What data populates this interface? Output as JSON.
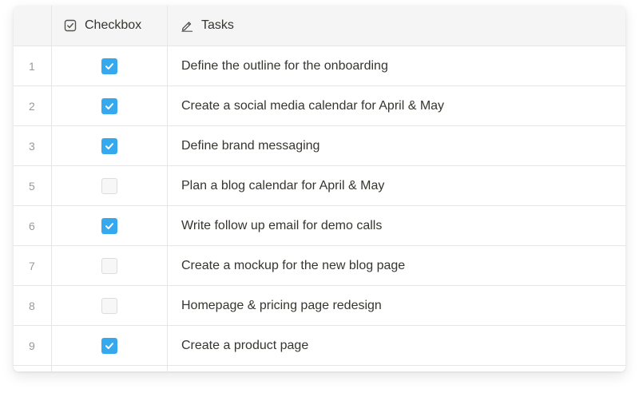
{
  "table": {
    "headers": {
      "checkbox": {
        "label": "Checkbox",
        "icon": "checkbox-icon"
      },
      "tasks": {
        "label": "Tasks",
        "icon": "pencil-icon"
      }
    },
    "rows": [
      {
        "num": "1",
        "checked": true,
        "task": "Define the outline for the onboarding"
      },
      {
        "num": "2",
        "checked": true,
        "task": "Create a social media calendar for April & May"
      },
      {
        "num": "3",
        "checked": true,
        "task": "Define brand messaging"
      },
      {
        "num": "5",
        "checked": false,
        "task": "Plan a blog calendar for April & May"
      },
      {
        "num": "6",
        "checked": true,
        "task": "Write follow up email for demo calls"
      },
      {
        "num": "7",
        "checked": false,
        "task": "Create a mockup for the new blog page"
      },
      {
        "num": "8",
        "checked": false,
        "task": "Homepage & pricing page redesign"
      },
      {
        "num": "9",
        "checked": true,
        "task": "Create a product page"
      }
    ]
  },
  "colors": {
    "accent": "#35a8ee",
    "text": "#37352f",
    "muted": "#9b9a97",
    "border": "#e6e6e6",
    "header_bg": "#f5f5f6"
  }
}
